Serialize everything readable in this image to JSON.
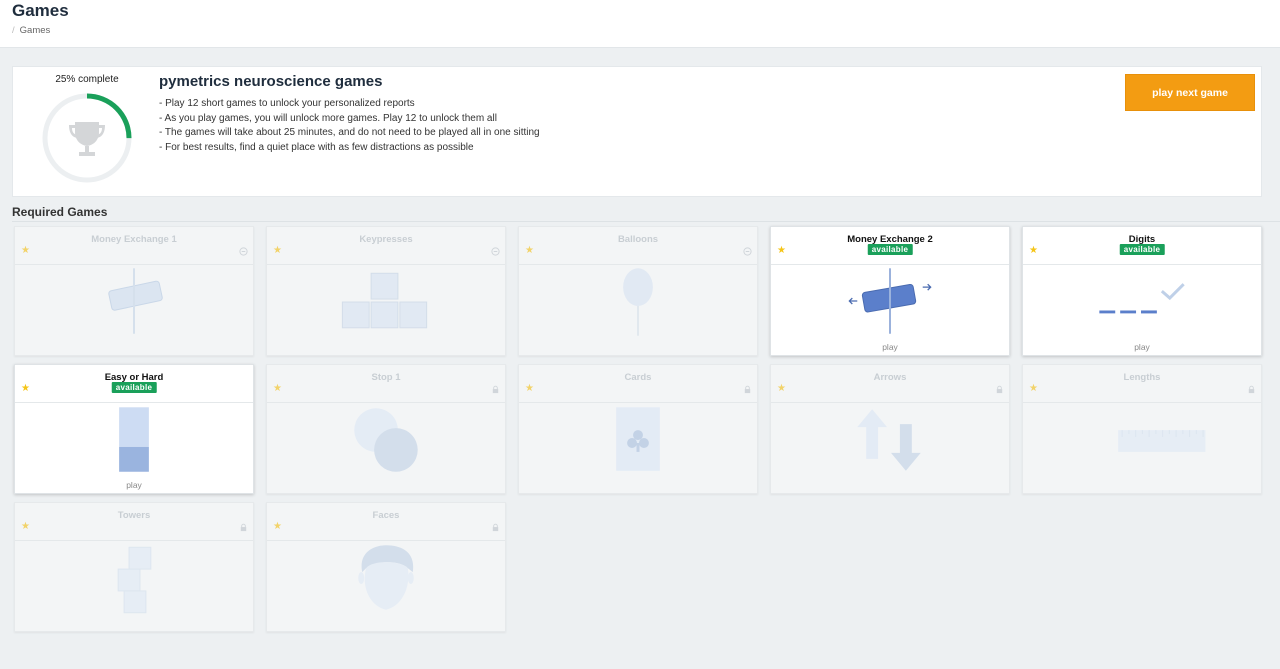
{
  "header": {
    "title": "Games",
    "breadcrumb": "Games"
  },
  "summary": {
    "progress_label": "25% complete",
    "progress": 0.25,
    "title": "pymetrics neuroscience games",
    "bullets": [
      "- Play 12 short games to unlock your personalized reports",
      "- As you play games, you will unlock more games. Play 12 to unlock them all",
      "- The games will take about 25 minutes, and do not need to be played all in one sitting",
      "- For best results, find a quiet place with as few distractions as possible"
    ],
    "cta_label": "play next game"
  },
  "section": {
    "title": "Required Games"
  },
  "games": [
    {
      "name": "Money Exchange 1",
      "status": "completed",
      "icon": "money-exchange-icon",
      "badge": "",
      "action": ""
    },
    {
      "name": "Keypresses",
      "status": "completed",
      "icon": "keypresses-icon",
      "badge": "",
      "action": ""
    },
    {
      "name": "Balloons",
      "status": "completed",
      "icon": "balloon-icon",
      "badge": "",
      "action": ""
    },
    {
      "name": "Money Exchange 2",
      "status": "available",
      "icon": "money-exchange-icon",
      "badge": "available",
      "action": "play"
    },
    {
      "name": "Digits",
      "status": "available",
      "icon": "digits-icon",
      "badge": "available",
      "action": "play"
    },
    {
      "name": "Easy or Hard",
      "status": "available",
      "icon": "easy-or-hard-icon",
      "badge": "available",
      "action": "play"
    },
    {
      "name": "Stop 1",
      "status": "locked",
      "icon": "circles-icon",
      "badge": "",
      "action": ""
    },
    {
      "name": "Cards",
      "status": "locked",
      "icon": "card-club-icon",
      "badge": "",
      "action": ""
    },
    {
      "name": "Arrows",
      "status": "locked",
      "icon": "arrows-icon",
      "badge": "",
      "action": ""
    },
    {
      "name": "Lengths",
      "status": "locked",
      "icon": "ruler-icon",
      "badge": "",
      "action": ""
    },
    {
      "name": "Towers",
      "status": "locked",
      "icon": "towers-icon",
      "badge": "",
      "action": ""
    },
    {
      "name": "Faces",
      "status": "locked",
      "icon": "face-icon",
      "badge": "",
      "action": ""
    }
  ],
  "colors": {
    "accent": "#f39c12",
    "progress": "#1aa05a",
    "badge": "#1aa05a",
    "star": "#f5c518",
    "art_active": "#5b7fcb",
    "art_muted": "#dbe5f1"
  }
}
